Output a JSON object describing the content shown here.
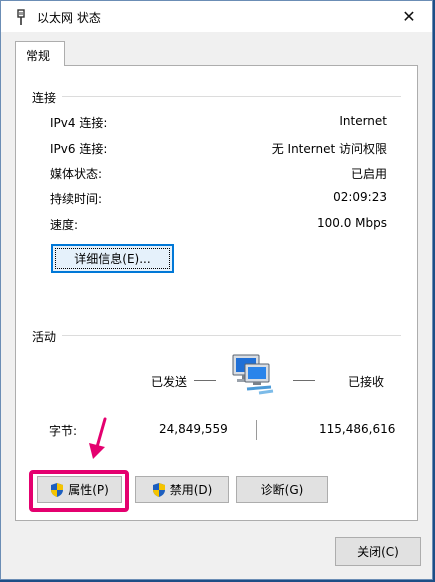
{
  "window": {
    "title": "以太网 状态",
    "close_glyph": "✕"
  },
  "tab": {
    "label": "常规"
  },
  "connection": {
    "group_label": "连接",
    "rows": [
      {
        "label": "IPv4 连接:",
        "value": "Internet"
      },
      {
        "label": "IPv6 连接:",
        "value": "无 Internet 访问权限"
      },
      {
        "label": "媒体状态:",
        "value": "已启用"
      },
      {
        "label": "持续时间:",
        "value": "02:09:23"
      },
      {
        "label": "速度:",
        "value": "100.0 Mbps"
      }
    ],
    "details_button": "详细信息(E)..."
  },
  "activity": {
    "group_label": "活动",
    "sent_label": "已发送",
    "received_label": "已接收",
    "bytes_label": "字节:",
    "bytes_sent": "24,849,559",
    "bytes_received": "115,486,616"
  },
  "buttons": {
    "properties": "属性(P)",
    "disable": "禁用(D)",
    "diagnose": "诊断(G)",
    "close": "关闭(C)"
  },
  "colors": {
    "highlight": "#e4006f",
    "desktop": "#1d4e86"
  }
}
